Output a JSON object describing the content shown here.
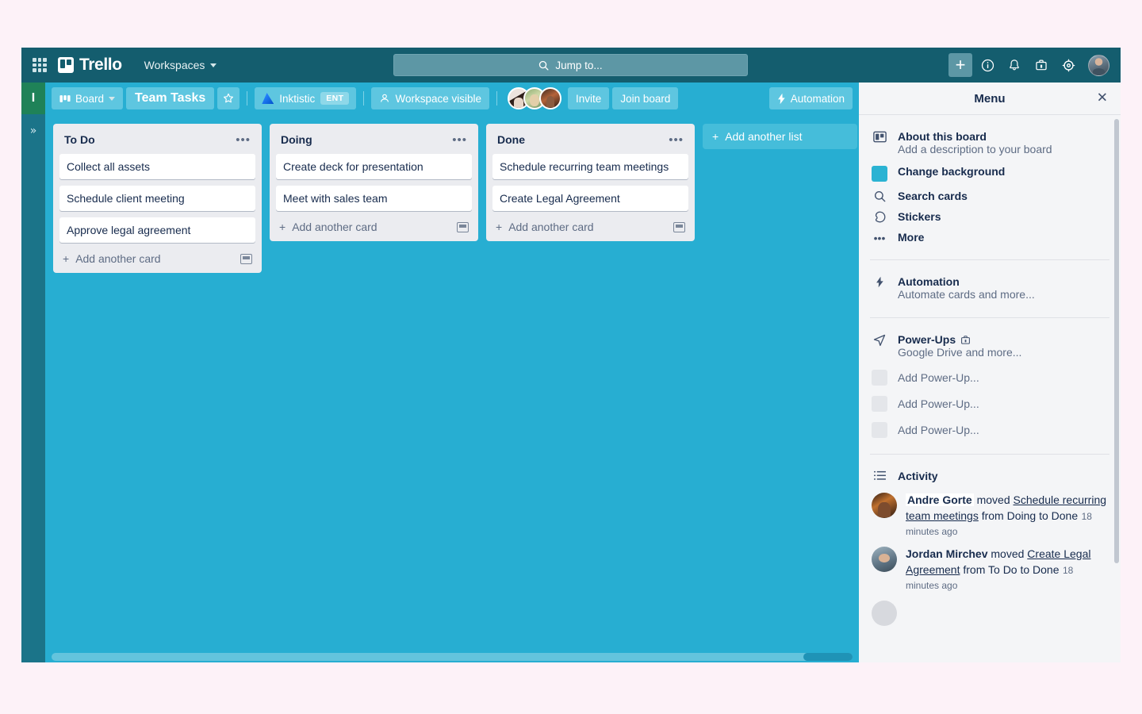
{
  "colors": {
    "page_bg": "#fdf2f8",
    "topnav_bg": "#145d6e",
    "board_bg": "#27aed2",
    "list_bg": "#ebecf0",
    "menu_bg": "#f4f5f7",
    "accent_swatch": "#2bb3d3",
    "rail_logo_bg": "#1f8258"
  },
  "topnav": {
    "apps_icon": "grid-apps-icon",
    "brand": "Trello",
    "workspaces_label": "Workspaces",
    "search_placeholder": "Jump to...",
    "search_icon": "search-icon",
    "buttons": [
      {
        "name": "create-button",
        "icon": "plus-icon",
        "glyph": "+"
      },
      {
        "name": "info-button",
        "icon": "info-circle-icon",
        "glyph": "ⓘ"
      },
      {
        "name": "notifications-button",
        "icon": "bell-icon",
        "glyph": "🔔"
      },
      {
        "name": "apps-suitcase-button",
        "icon": "briefcase-icon",
        "glyph": "💼"
      },
      {
        "name": "settings-button",
        "icon": "gear-icon",
        "glyph": "⚙"
      }
    ],
    "avatar_name": "user-avatar"
  },
  "left_rail": {
    "workspace_initial": "I",
    "expand_label": "»"
  },
  "board_header": {
    "view_label": "Board",
    "view_icon": "board-view-icon",
    "board_title": "Team Tasks",
    "star_icon": "star-icon",
    "workspace_name": "Inktistic",
    "workspace_badge": "ENT",
    "visibility_label": "Workspace visible",
    "visibility_icon": "workspace-visible-icon",
    "invite_label": "Invite",
    "join_label": "Join board",
    "automation_label": "Automation",
    "automation_icon": "lightning-bolt-icon",
    "members": [
      "member-avatar-1",
      "member-avatar-2",
      "member-avatar-3"
    ]
  },
  "lists": [
    {
      "title": "To Do",
      "cards": [
        "Collect all assets",
        "Schedule client meeting",
        "Approve legal agreement"
      ],
      "add_card_label": "Add another card",
      "template_icon": "card-template-icon"
    },
    {
      "title": "Doing",
      "cards": [
        "Create deck for presentation",
        "Meet with sales team"
      ],
      "add_card_label": "Add another card",
      "template_icon": "card-template-icon"
    },
    {
      "title": "Done",
      "cards": [
        "Schedule recurring team meetings",
        "Create Legal Agreement"
      ],
      "add_card_label": "Add another card",
      "template_icon": "card-template-icon"
    }
  ],
  "add_list_label": "Add another list",
  "menu": {
    "title": "Menu",
    "close_icon": "close-icon",
    "section_board": [
      {
        "icon": "board-icon",
        "title": "About this board",
        "subtitle": "Add a description to your board"
      },
      {
        "icon": "color-swatch-icon",
        "title": "Change background",
        "subtitle": ""
      },
      {
        "icon": "search-icon",
        "title": "Search cards",
        "subtitle": ""
      },
      {
        "icon": "sticker-icon",
        "title": "Stickers",
        "subtitle": ""
      },
      {
        "icon": "more-dots-icon",
        "title": "More",
        "subtitle": ""
      }
    ],
    "automation": {
      "icon": "lightning-bolt-icon",
      "title": "Automation",
      "subtitle": "Automate cards and more..."
    },
    "powerups": {
      "icon": "rocket-icon",
      "title": "Power-Ups",
      "badge_icon": "briefcase-icon",
      "subtitle": "Google Drive and more...",
      "items": [
        "Add Power-Up...",
        "Add Power-Up...",
        "Add Power-Up..."
      ]
    },
    "activity": {
      "icon": "activity-list-icon",
      "title": "Activity",
      "entries": [
        {
          "avatar": "andre-gorte-avatar",
          "user": "Andre Gorte",
          "verb": "moved",
          "card": "Schedule recurring team meetings",
          "detail": "from Doing to Done",
          "time": "18 minutes ago"
        },
        {
          "avatar": "jordan-mirchev-avatar",
          "user": "Jordan Mirchev",
          "verb": "moved",
          "card": "Create Legal Agreement",
          "detail": "from To Do to Done",
          "time": "18 minutes ago"
        }
      ]
    }
  }
}
